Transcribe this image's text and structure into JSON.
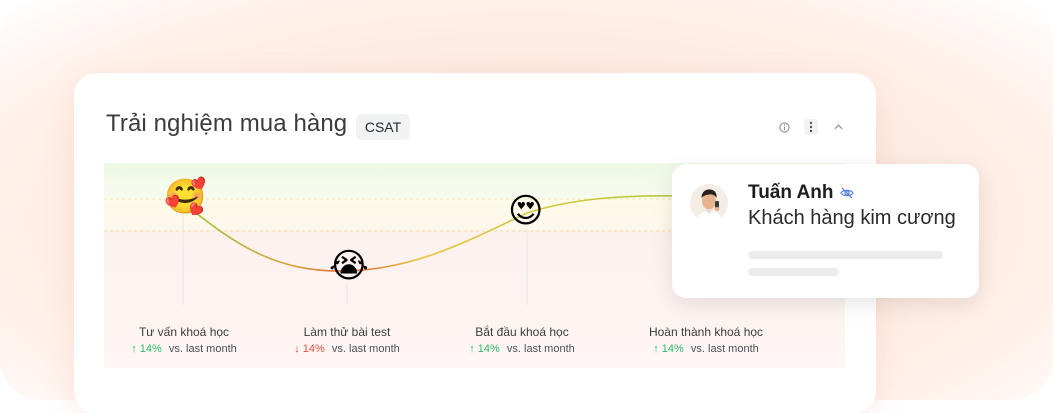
{
  "card": {
    "title": "Trải nghiệm mua hàng",
    "badge": "CSAT"
  },
  "icons": {
    "info": "info-icon",
    "more": "more-vertical-icon",
    "collapse": "chevron-up-icon",
    "hidden": "eye-off-icon"
  },
  "colors": {
    "accent_green": "#2eb86a",
    "accent_red": "#ea4c3a",
    "line_good": "#a3c93a",
    "line_bad": "#e06a3a"
  },
  "journey": {
    "stages": [
      {
        "name": "Tư vấn khoá học",
        "emoji": "🥰",
        "direction": "↑",
        "change": "14%",
        "compare": "vs. last month"
      },
      {
        "name": "Làm thử bài test",
        "emoji": "😭",
        "direction": "↓",
        "change": "14%",
        "compare": "vs. last month"
      },
      {
        "name": "Bắt đầu khoá học",
        "emoji": "😍",
        "direction": "↑",
        "change": "14%",
        "compare": "vs. last month"
      },
      {
        "name": "Hoàn thành khoá học",
        "emoji": "",
        "direction": "↑",
        "change": "14%",
        "compare": "vs. last month"
      }
    ]
  },
  "profile": {
    "name": "Tuấn Anh",
    "tier": "Khách hàng kim cương"
  }
}
